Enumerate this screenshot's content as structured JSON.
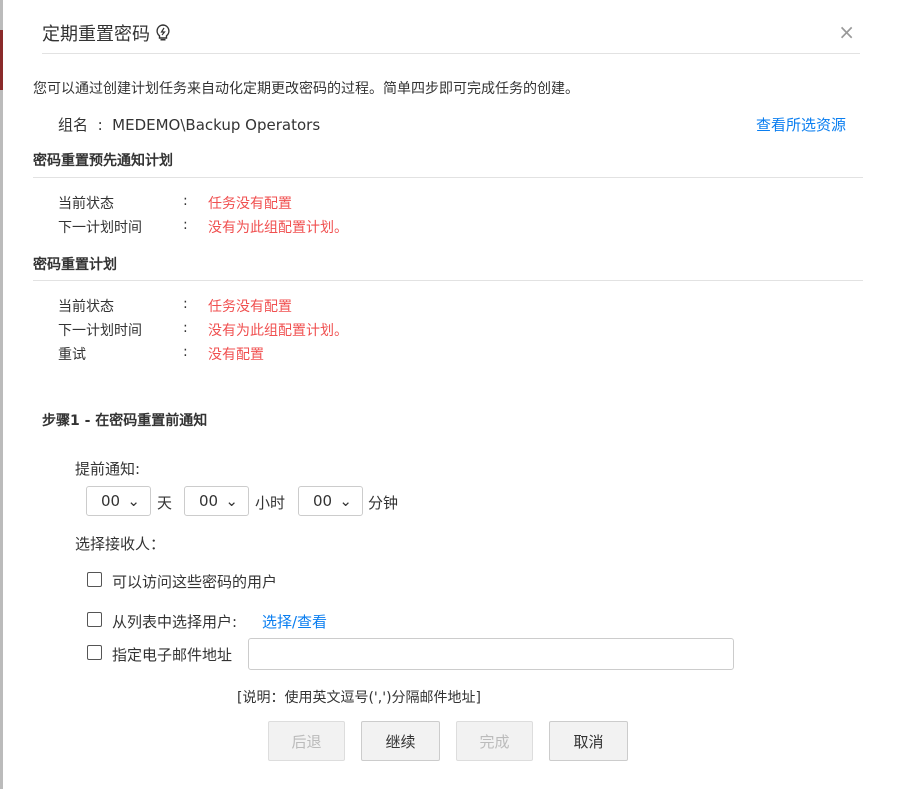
{
  "dialog": {
    "title": "定期重置密码",
    "close": "×"
  },
  "intro": "您可以通过创建计划任务来自动化定期更改密码的过程。简单四步即可完成任务的创建。",
  "group": {
    "label": "组名",
    "sep": ":",
    "value": "MEDEMO\\Backup Operators",
    "link": "查看所选资源"
  },
  "notify_plan": {
    "heading": "密码重置预先通知计划",
    "rows": [
      {
        "label": "当前状态",
        "value": "任务没有配置"
      },
      {
        "label": "下一计划时间",
        "value": "没有为此组配置计划。"
      }
    ]
  },
  "reset_plan": {
    "heading": "密码重置计划",
    "rows": [
      {
        "label": "当前状态",
        "value": "任务没有配置"
      },
      {
        "label": "下一计划时间",
        "value": "没有为此组配置计划。"
      },
      {
        "label": "重试",
        "value": "没有配置"
      }
    ]
  },
  "colon": ":",
  "step": {
    "heading": "步骤1 - 在密码重置前通知",
    "advance_label": "提前通知:",
    "days": {
      "value": "00",
      "unit": "天"
    },
    "hours": {
      "value": "00",
      "unit": "小时"
    },
    "minutes": {
      "value": "00",
      "unit": "分钟"
    },
    "recipients_label": "选择接收人：",
    "options": [
      {
        "label": "可以访问这些密码的用户",
        "checked": false
      },
      {
        "label": "从列表中选择用户:",
        "link": "选择/查看",
        "checked": false
      },
      {
        "label": "指定电子邮件地址",
        "checked": false
      }
    ],
    "email_value": "",
    "note": "[说明：使用英文逗号(',')分隔邮件地址]"
  },
  "buttons": {
    "back": "后退",
    "continue": "继续",
    "finish": "完成",
    "cancel": "取消"
  }
}
